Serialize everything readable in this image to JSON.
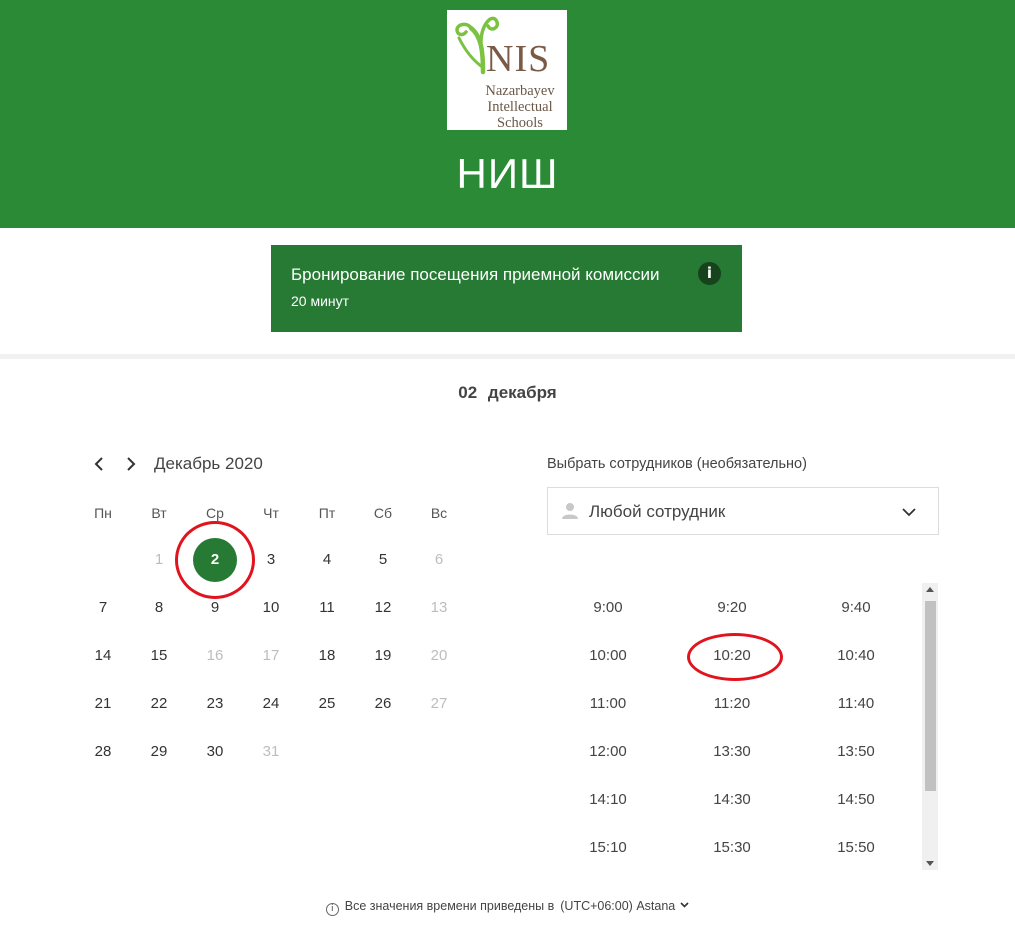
{
  "header": {
    "logo": {
      "text": "NIS",
      "lines": [
        "Nazarbayev",
        "Intellectual",
        "Schools"
      ]
    },
    "brand": "НИШ",
    "color": "#2b8a36"
  },
  "service": {
    "title": "Бронирование посещения приемной комиссии",
    "duration": "20 минут",
    "info_icon": "i",
    "color": "#267a33"
  },
  "selected_date": {
    "day": "02",
    "month": "декабря"
  },
  "calendar": {
    "month_label": "Декабрь 2020",
    "weekdays": [
      "Пн",
      "Вт",
      "Ср",
      "Чт",
      "Пт",
      "Сб",
      "Вс"
    ],
    "weeks": [
      [
        null,
        {
          "d": "1",
          "off": true
        },
        {
          "d": "2",
          "sel": true
        },
        {
          "d": "3"
        },
        {
          "d": "4"
        },
        {
          "d": "5"
        },
        {
          "d": "6",
          "off": true
        }
      ],
      [
        {
          "d": "7"
        },
        {
          "d": "8"
        },
        {
          "d": "9"
        },
        {
          "d": "10"
        },
        {
          "d": "11"
        },
        {
          "d": "12"
        },
        {
          "d": "13",
          "off": true
        }
      ],
      [
        {
          "d": "14"
        },
        {
          "d": "15"
        },
        {
          "d": "16",
          "off": true
        },
        {
          "d": "17",
          "off": true
        },
        {
          "d": "18"
        },
        {
          "d": "19"
        },
        {
          "d": "20",
          "off": true
        }
      ],
      [
        {
          "d": "21"
        },
        {
          "d": "22"
        },
        {
          "d": "23"
        },
        {
          "d": "24"
        },
        {
          "d": "25"
        },
        {
          "d": "26"
        },
        {
          "d": "27",
          "off": true
        }
      ],
      [
        {
          "d": "28"
        },
        {
          "d": "29"
        },
        {
          "d": "30"
        },
        {
          "d": "31",
          "off": true
        },
        null,
        null,
        null
      ]
    ]
  },
  "staff": {
    "label": "Выбрать сотрудников (необязательно)",
    "value": "Любой сотрудник"
  },
  "slots": [
    [
      "9:00",
      "9:20",
      "9:40"
    ],
    [
      "10:00",
      "10:20",
      "10:40"
    ],
    [
      "11:00",
      "11:20",
      "11:40"
    ],
    [
      "12:00",
      "13:30",
      "13:50"
    ],
    [
      "14:10",
      "14:30",
      "14:50"
    ],
    [
      "15:10",
      "15:30",
      "15:50"
    ]
  ],
  "timezone": {
    "note": "Все значения времени приведены в",
    "value": "(UTC+06:00) Astana"
  },
  "annotation_color": "#e0141e"
}
